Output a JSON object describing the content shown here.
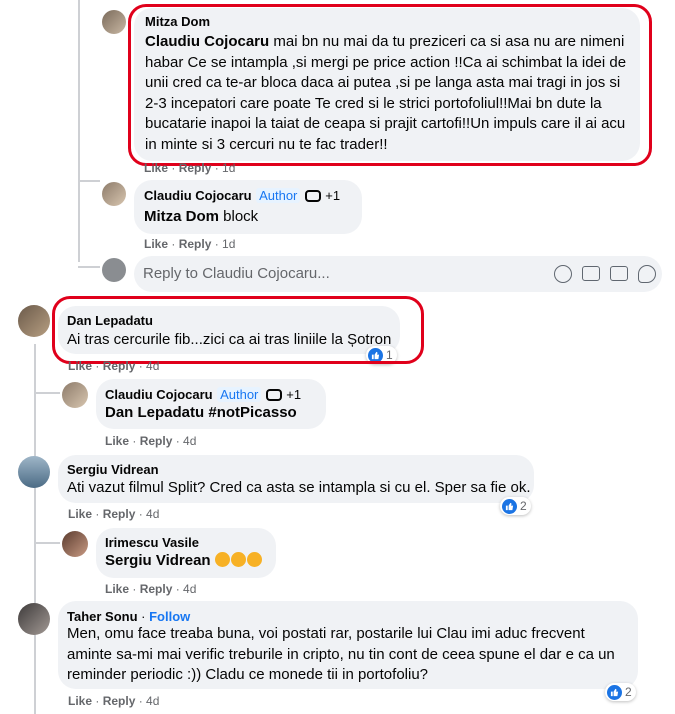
{
  "icons": {
    "like": "like-icon",
    "laugh": "laugh-emoji-icon",
    "badge": "top-fan-badge-icon"
  },
  "colors": {
    "accent": "#1877f2",
    "highlight": "#e0001b",
    "bubble": "#f0f2f5",
    "muted": "#65676b"
  },
  "comments": {
    "c1": {
      "name": "Mitza Dom",
      "mention": "Claudiu Cojocaru",
      "text_l1": " mai bn nu mai da tu preziceri ca si asa nu are nimeni",
      "text_l2": "habar Ce se intampla ,si mergi pe price action !!Ca ai schimbat la idei de",
      "text_l3": "unii cred ca te-ar bloca daca ai putea ,si pe langa asta mai tragi in jos si",
      "text_l4": "2-3 incepatori care poate Te cred si le strici portofoliul!!Mai bn dute la",
      "text_l5": "bucatarie inapoi la taiat de ceapa si prajit cartofi!!Un impuls care il ai acu",
      "text_l6": "in minte si 3 cercuri nu te fac trader!!",
      "like": "Like",
      "reply": "Reply",
      "time": "1d"
    },
    "c2": {
      "name": "Claudiu Cojocaru",
      "author": "Author",
      "plus": "+1",
      "mention": "Mitza Dom",
      "text": " block",
      "like": "Like",
      "reply": "Reply",
      "time": "1d"
    },
    "reply_box": {
      "placeholder": "Reply to Claudiu Cojocaru..."
    },
    "c3": {
      "name": "Dan Lepadatu",
      "text": "Ai tras cercurile fib...zici ca ai tras liniile la Șotron",
      "reactions": "1",
      "like": "Like",
      "reply": "Reply",
      "time": "4d"
    },
    "c4": {
      "name": "Claudiu Cojocaru",
      "author": "Author",
      "plus": "+1",
      "mention": "Dan Lepadatu",
      "text": " #notPicasso",
      "like": "Like",
      "reply": "Reply",
      "time": "4d"
    },
    "c5": {
      "name": "Sergiu Vidrean",
      "text": "Ati vazut filmul Split? Cred ca asta se intampla si cu el. Sper sa fie ok.",
      "reactions": "2",
      "like": "Like",
      "reply": "Reply",
      "time": "4d"
    },
    "c6": {
      "name": "Irimescu Vasile",
      "mention": "Sergiu Vidrean",
      "like": "Like",
      "reply": "Reply",
      "time": "4d"
    },
    "c7": {
      "name": "Taher Sonu",
      "dot": " · ",
      "follow": "Follow",
      "text_l1": "Men, omu face treaba buna, voi postati rar, postarile lui Clau imi aduc frecvent",
      "text_l2": "aminte sa-mi mai verific treburile in cripto, nu tin cont de ceea spune el dar e ca un",
      "text_l3": "reminder periodic :)) Cladu ce monede tii in portofoliu?",
      "reactions": "2",
      "like": "Like",
      "reply": "Reply",
      "time": "4d"
    }
  }
}
